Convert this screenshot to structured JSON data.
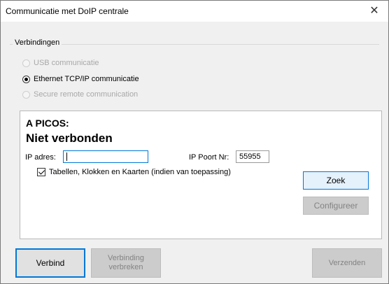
{
  "window": {
    "title": "Communicatie met DoIP centrale",
    "close_glyph": "✕"
  },
  "connections": {
    "group_label": "Verbindingen",
    "options": [
      {
        "label": "USB communicatie",
        "selected": false,
        "enabled": false
      },
      {
        "label": "Ethernet TCP/IP communicatie",
        "selected": true,
        "enabled": true
      },
      {
        "label": "Secure remote communication",
        "selected": false,
        "enabled": false
      }
    ]
  },
  "panel": {
    "target_label": "A PICOS:",
    "status_label": "Niet verbonden",
    "ip_label": "IP adres:",
    "ip_value": "",
    "port_label": "IP Poort Nr:",
    "port_value": "55955",
    "checkbox_label": "Tabellen, Klokken en Kaarten (indien van toepassing)",
    "checkbox_checked": true,
    "zoek_label": "Zoek",
    "configureer_label": "Configureer"
  },
  "footer": {
    "verbind_label": "Verbind",
    "verbreken_line1": "Verbinding",
    "verbreken_line2": "verbreken",
    "verzenden_label": "Verzenden"
  },
  "colors": {
    "accent": "#0078d7",
    "disabled_text": "#a8a8a8",
    "window_bg": "#f0f0f0"
  },
  "icons": {
    "close": "close-icon",
    "radio": "radio-button",
    "checkbox": "checkbox"
  }
}
